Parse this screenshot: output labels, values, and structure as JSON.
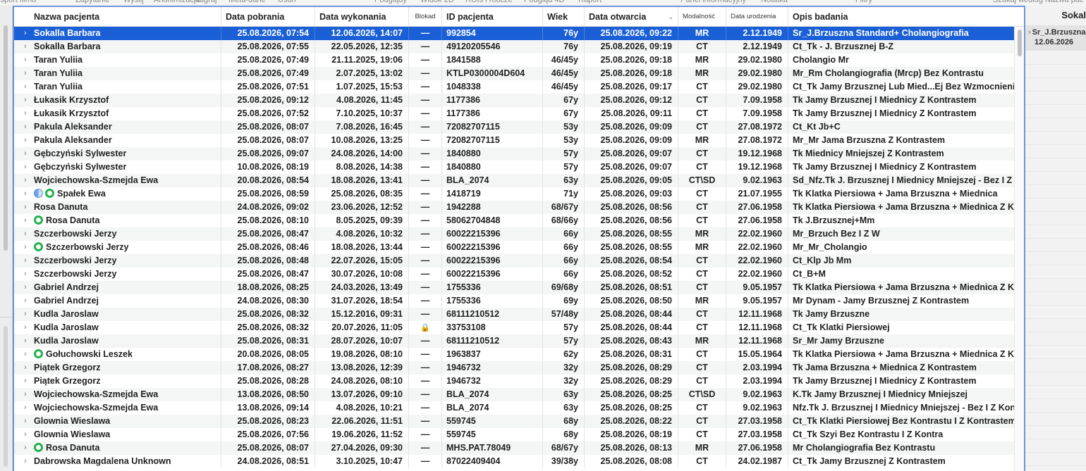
{
  "toolbar": {
    "items": [
      "ksport filmu",
      "Zapytanie",
      "Wyślij",
      "Anonimizacja",
      "Nagraj",
      "Meta-dane",
      "Usuń",
      "Podglądy",
      "Widok 2D",
      "ROIs i Klucze",
      "Podgląd 4D",
      "Raport",
      "Panel informacyjny",
      "Notatka",
      "Filtry",
      "Szukaj według Nazwa pac"
    ]
  },
  "columns": {
    "name": "Nazwa pacjenta",
    "acquired": "Data pobrania",
    "performed": "Data wykonania",
    "locked": "Blokad",
    "patient_id": "ID pacjenta",
    "age": "Wiek",
    "opened": "Data otwarcia",
    "modality": "Modalność",
    "birth": "Data urodzenia",
    "description": "Opis badania"
  },
  "rows": [
    {
      "name": "Sokalla Barbara",
      "status": "",
      "acquired": "25.08.2026, 07:54",
      "performed": "12.06.2026, 14:07",
      "lock": "—",
      "patient_id": "992854",
      "age": "76y",
      "opened": "25.08.2026, 09:22",
      "modality": "MR",
      "birth": "2.12.1949",
      "description": "Sr_J.Brzuszna Standard+ Cholangiografia"
    },
    {
      "name": "Sokalla Barbara",
      "status": "",
      "acquired": "25.08.2026, 07:55",
      "performed": "22.05.2026, 12:35",
      "lock": "—",
      "patient_id": "49120205546",
      "age": "76y",
      "opened": "25.08.2026, 09:19",
      "modality": "CT",
      "birth": "2.12.1949",
      "description": "Ct_Tk - J. Brzusznej B-Z"
    },
    {
      "name": "Taran Yuliia",
      "status": "",
      "acquired": "25.08.2026, 07:49",
      "performed": "21.11.2025, 19:06",
      "lock": "—",
      "patient_id": "1841588",
      "age": "46/45y",
      "opened": "25.08.2026, 09:18",
      "modality": "MR",
      "birth": "29.02.1980",
      "description": "Cholangio Mr"
    },
    {
      "name": "Taran Yuliia",
      "status": "",
      "acquired": "25.08.2026, 07:49",
      "performed": "2.07.2025, 13:02",
      "lock": "—",
      "patient_id": "KTLP0300004D604",
      "age": "46/45y",
      "opened": "25.08.2026, 09:18",
      "modality": "MR",
      "birth": "29.02.1980",
      "description": "Mr_Rm Cholangiografia (Mrcp) Bez Kontrastu"
    },
    {
      "name": "Taran Yuliia",
      "status": "",
      "acquired": "25.08.2026, 07:51",
      "performed": "1.07.2025, 15:53",
      "lock": "—",
      "patient_id": "1048338",
      "age": "46/45y",
      "opened": "25.08.2026, 09:17",
      "modality": "CT",
      "birth": "29.02.1980",
      "description": "Ct_Tk Jamy Brzusznej Lub Mied...Ej Bez Wzmocnienia"
    },
    {
      "name": "Łukasik Krzysztof",
      "status": "",
      "acquired": "25.08.2026, 09:12",
      "performed": "4.08.2026, 11:45",
      "lock": "—",
      "patient_id": "1177386",
      "age": "67y",
      "opened": "25.08.2026, 09:12",
      "modality": "CT",
      "birth": "7.09.1958",
      "description": "Tk Jamy Brzusznej I Miednicy Z Kontrastem"
    },
    {
      "name": "Łukasik Krzysztof",
      "status": "",
      "acquired": "25.08.2026, 07:52",
      "performed": "7.10.2025, 10:37",
      "lock": "—",
      "patient_id": "1177386",
      "age": "67y",
      "opened": "25.08.2026, 09:11",
      "modality": "CT",
      "birth": "7.09.1958",
      "description": "Tk Jamy Brzusznej I Miednicy Z Kontrastem"
    },
    {
      "name": "Pakula Aleksander",
      "status": "",
      "acquired": "25.08.2026, 08:07",
      "performed": "7.08.2026, 16:45",
      "lock": "—",
      "patient_id": "72082707115",
      "age": "53y",
      "opened": "25.08.2026, 09:09",
      "modality": "CT",
      "birth": "27.08.1972",
      "description": "Ct_Kt Jb+C"
    },
    {
      "name": "Pakula Aleksander",
      "status": "",
      "acquired": "25.08.2026, 08:07",
      "performed": "10.08.2026, 13:25",
      "lock": "—",
      "patient_id": "72082707115",
      "age": "53y",
      "opened": "25.08.2026, 09:09",
      "modality": "MR",
      "birth": "27.08.1972",
      "description": "Mr_Mr Jama Brzuszna Z Kontrastem"
    },
    {
      "name": "Gębczyński Sylwester",
      "status": "",
      "acquired": "25.08.2026, 09:07",
      "performed": "24.08.2026, 14:00",
      "lock": "—",
      "patient_id": "1840880",
      "age": "57y",
      "opened": "25.08.2026, 09:07",
      "modality": "CT",
      "birth": "19.12.1968",
      "description": "Tk Miednicy Mniejszej Z Kontrastem"
    },
    {
      "name": "Gębczyński Sylwester",
      "status": "",
      "acquired": "10.08.2026, 08:19",
      "performed": "8.08.2026, 14:38",
      "lock": "—",
      "patient_id": "1840880",
      "age": "57y",
      "opened": "25.08.2026, 09:07",
      "modality": "CT",
      "birth": "19.12.1968",
      "description": "Tk Jamy Brzusznej I Miednicy Z Kontrastem"
    },
    {
      "name": "Wojciechowska-Szmejda Ewa",
      "status": "",
      "acquired": "20.08.2026, 08:54",
      "performed": "18.08.2026, 13:41",
      "lock": "—",
      "patient_id": "BLA_2074",
      "age": "63y",
      "opened": "25.08.2026, 09:05",
      "modality": "CT\\SD",
      "birth": "9.02.1963",
      "description": "Sd_Nfz.Tk J. Brzusznej I Miednicy Mniejszej - Bez I Z"
    },
    {
      "name": "Spałek Ewa",
      "status": "half-green",
      "acquired": "25.08.2026, 08:59",
      "performed": "25.08.2026, 08:35",
      "lock": "—",
      "patient_id": "1418719",
      "age": "71y",
      "opened": "25.08.2026, 09:03",
      "modality": "CT",
      "birth": "21.07.1955",
      "description": "Tk Klatka Piersiowa + Jama Brzuszna + Miednica"
    },
    {
      "name": "Rosa Danuta",
      "status": "",
      "acquired": "24.08.2026, 09:02",
      "performed": "23.06.2026, 12:52",
      "lock": "—",
      "patient_id": "1942288",
      "age": "68/67y",
      "opened": "25.08.2026, 08:56",
      "modality": "CT",
      "birth": "27.06.1958",
      "description": "Tk Klatka Piersiowa + Jama Brzuszna + Miednica Z K"
    },
    {
      "name": "Rosa Danuta",
      "status": "green",
      "acquired": "25.08.2026, 08:10",
      "performed": "8.05.2025, 09:39",
      "lock": "—",
      "patient_id": "58062704848",
      "age": "68/66y",
      "opened": "25.08.2026, 08:56",
      "modality": "CT",
      "birth": "27.06.1958",
      "description": "Tk J.Brzusznej+Mm"
    },
    {
      "name": "Szczerbowski Jerzy",
      "status": "",
      "acquired": "25.08.2026, 08:47",
      "performed": "4.08.2026, 10:32",
      "lock": "—",
      "patient_id": "60022215396",
      "age": "66y",
      "opened": "25.08.2026, 08:55",
      "modality": "MR",
      "birth": "22.02.1960",
      "description": "Mr_Brzuch Bez I Z W"
    },
    {
      "name": "Szczerbowski Jerzy",
      "status": "green",
      "acquired": "25.08.2026, 08:46",
      "performed": "18.08.2026, 13:44",
      "lock": "—",
      "patient_id": "60022215396",
      "age": "66y",
      "opened": "25.08.2026, 08:55",
      "modality": "MR",
      "birth": "22.02.1960",
      "description": "Mr_Mr_Cholangio"
    },
    {
      "name": "Szczerbowski Jerzy",
      "status": "",
      "acquired": "25.08.2026, 08:48",
      "performed": "22.07.2026, 15:05",
      "lock": "—",
      "patient_id": "60022215396",
      "age": "66y",
      "opened": "25.08.2026, 08:54",
      "modality": "CT",
      "birth": "22.02.1960",
      "description": "Ct_Klp Jb Mm"
    },
    {
      "name": "Szczerbowski Jerzy",
      "status": "",
      "acquired": "25.08.2026, 08:47",
      "performed": "30.07.2026, 10:08",
      "lock": "—",
      "patient_id": "60022215396",
      "age": "66y",
      "opened": "25.08.2026, 08:52",
      "modality": "CT",
      "birth": "22.02.1960",
      "description": "Ct_B+M"
    },
    {
      "name": "Gabriel Andrzej",
      "status": "",
      "acquired": "18.08.2026, 08:25",
      "performed": "24.03.2026, 13:49",
      "lock": "—",
      "patient_id": "1755336",
      "age": "69/68y",
      "opened": "25.08.2026, 08:51",
      "modality": "CT",
      "birth": "9.05.1957",
      "description": "Tk Klatka Piersiowa + Jama Brzuszna + Miednica Z K"
    },
    {
      "name": "Gabriel Andrzej",
      "status": "",
      "acquired": "24.08.2026, 08:30",
      "performed": "31.07.2026, 18:54",
      "lock": "—",
      "patient_id": "1755336",
      "age": "69y",
      "opened": "25.08.2026, 08:50",
      "modality": "MR",
      "birth": "9.05.1957",
      "description": "Mr Dynam - Jamy Brzusznej Z Kontrastem"
    },
    {
      "name": "Kudla Jaroslaw",
      "status": "",
      "acquired": "25.08.2026, 08:32",
      "performed": "15.12.2016, 09:31",
      "lock": "—",
      "patient_id": "68111210512",
      "age": "57/48y",
      "opened": "25.08.2026, 08:44",
      "modality": "CT",
      "birth": "12.11.1968",
      "description": "Tk Jamy Brzuszne"
    },
    {
      "name": "Kudla Jaroslaw",
      "status": "",
      "acquired": "25.08.2026, 08:32",
      "performed": "20.07.2026, 11:05",
      "lock": "lock",
      "patient_id": "33753108",
      "age": "57y",
      "opened": "25.08.2026, 08:44",
      "modality": "CT",
      "birth": "12.11.1968",
      "description": "Ct_Tk Klatki Piersiowej"
    },
    {
      "name": "Kudla Jaroslaw",
      "status": "",
      "acquired": "25.08.2026, 08:31",
      "performed": "28.07.2026, 10:07",
      "lock": "—",
      "patient_id": "68111210512",
      "age": "57y",
      "opened": "25.08.2026, 08:43",
      "modality": "MR",
      "birth": "12.11.1968",
      "description": "Sr_Mr Jamy Brzuszne"
    },
    {
      "name": "Gołuchowski Leszek",
      "status": "green",
      "acquired": "20.08.2026, 08:05",
      "performed": "19.08.2026, 08:10",
      "lock": "—",
      "patient_id": "1963837",
      "age": "62y",
      "opened": "25.08.2026, 08:31",
      "modality": "CT",
      "birth": "15.05.1964",
      "description": "Tk Klatka Piersiowa + Jama Brzuszna + Miednica Z K"
    },
    {
      "name": "Piątek Grzegorz",
      "status": "",
      "acquired": "17.08.2026, 08:27",
      "performed": "13.08.2026, 12:39",
      "lock": "—",
      "patient_id": "1946732",
      "age": "32y",
      "opened": "25.08.2026, 08:29",
      "modality": "CT",
      "birth": "2.03.1994",
      "description": "Tk Jama Brzuszna + Miednica Z Kontrastem"
    },
    {
      "name": "Piątek Grzegorz",
      "status": "",
      "acquired": "25.08.2026, 08:28",
      "performed": "24.08.2026, 08:10",
      "lock": "—",
      "patient_id": "1946732",
      "age": "32y",
      "opened": "25.08.2026, 08:29",
      "modality": "CT",
      "birth": "2.03.1994",
      "description": "Tk Jamy Brzusznej I Miednicy Z Kontrastem"
    },
    {
      "name": "Wojciechowska-Szmejda Ewa",
      "status": "",
      "acquired": "13.08.2026, 08:50",
      "performed": "13.07.2026, 09:10",
      "lock": "—",
      "patient_id": "BLA_2074",
      "age": "63y",
      "opened": "25.08.2026, 08:25",
      "modality": "CT\\SD",
      "birth": "9.02.1963",
      "description": "K.Tk Jamy Brzusznej I Miednicy Mniejszej"
    },
    {
      "name": "Wojciechowska-Szmejda Ewa",
      "status": "",
      "acquired": "13.08.2026, 09:14",
      "performed": "4.08.2026, 10:21",
      "lock": "—",
      "patient_id": "BLA_2074",
      "age": "63y",
      "opened": "25.08.2026, 08:25",
      "modality": "CT",
      "birth": "9.02.1963",
      "description": "Nfz.Tk J. Brzusznej I Miednicy Mniejszej - Bez I Z Kon"
    },
    {
      "name": "Glownia Wieslawa",
      "status": "",
      "acquired": "25.08.2026, 08:23",
      "performed": "22.06.2026, 11:51",
      "lock": "—",
      "patient_id": "559745",
      "age": "68y",
      "opened": "25.08.2026, 08:22",
      "modality": "CT",
      "birth": "27.03.1958",
      "description": "Ct_Tk Klatki Piersiowej Bez Kontrastu I Z Kontrastem"
    },
    {
      "name": "Glownia Wieslawa",
      "status": "",
      "acquired": "25.08.2026, 07:56",
      "performed": "19.06.2026, 11:52",
      "lock": "—",
      "patient_id": "559745",
      "age": "68y",
      "opened": "25.08.2026, 08:19",
      "modality": "CT",
      "birth": "27.03.1958",
      "description": "Ct_Tk Szyi Bez Kontrastu I Z Kontra"
    },
    {
      "name": "Rosa Danuta",
      "status": "green",
      "acquired": "25.08.2026, 08:07",
      "performed": "27.04.2026, 09:30",
      "lock": "—",
      "patient_id": "MHS.PAT.78049",
      "age": "68/67y",
      "opened": "25.08.2026, 08:13",
      "modality": "MR",
      "birth": "27.06.1958",
      "description": "Mr Cholangiografia Bez Kontrastu"
    },
    {
      "name": "Dabrowska Magdalena Unknown",
      "status": "",
      "acquired": "24.08.2026, 08:51",
      "performed": "3.10.2025, 10:47",
      "lock": "—",
      "patient_id": "87022409404",
      "age": "39/38y",
      "opened": "25.08.2026, 08:08",
      "modality": "CT",
      "birth": "24.02.1987",
      "description": "Ct_Tk Jamy Brzusznej Z Kontrastem"
    }
  ],
  "right_panel": {
    "header": "Sokal",
    "item_line1": "Sr_J.Brzuszna",
    "item_line2": "12.06.2026"
  },
  "colors": {
    "selection": "#1a5fd6",
    "frame": "#6f95d6",
    "status_green": "#22b14c"
  }
}
